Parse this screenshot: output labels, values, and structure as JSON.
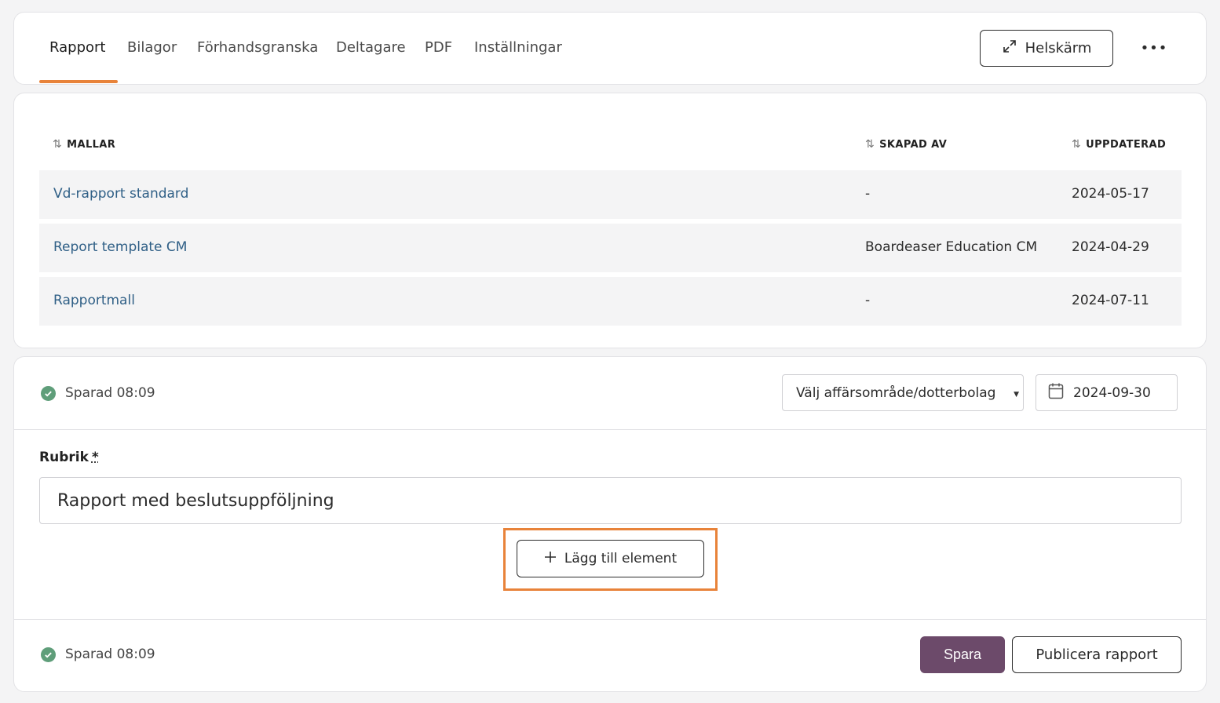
{
  "tabs": [
    {
      "label": "Rapport",
      "active": true
    },
    {
      "label": "Bilagor",
      "active": false
    },
    {
      "label": "Förhandsgranska",
      "active": false
    },
    {
      "label": "Deltagare",
      "active": false
    },
    {
      "label": "PDF",
      "active": false
    },
    {
      "label": "Inställningar",
      "active": false
    }
  ],
  "header": {
    "fullscreen_label": "Helskärm",
    "more_label": "•••"
  },
  "templates": {
    "columns": [
      "MALLAR",
      "SKAPAD AV",
      "UPPDATERAD"
    ],
    "rows": [
      {
        "name": "Vd-rapport standard",
        "created_by": "-",
        "updated": "2024-05-17"
      },
      {
        "name": "Report template CM",
        "created_by": "Boardeaser Education CM",
        "updated": "2024-04-29"
      },
      {
        "name": "Rapportmall",
        "created_by": "-",
        "updated": "2024-07-11"
      }
    ]
  },
  "editor": {
    "saved_status": "Sparad 08:09",
    "area_select": "Välj affärsområde/dotterbolag",
    "date": "2024-09-30",
    "rubrik_label": "Rubrik",
    "required_marker": "*",
    "rubrik_value": "Rapport med beslutsuppföljning",
    "add_element_label": "Lägg till element",
    "save_label": "Spara",
    "publish_label": "Publicera rapport"
  },
  "colors": {
    "accent": "#e8833a",
    "primary_button": "#6c4a6a",
    "link": "#2f5f86",
    "success": "#5f9e7a"
  }
}
